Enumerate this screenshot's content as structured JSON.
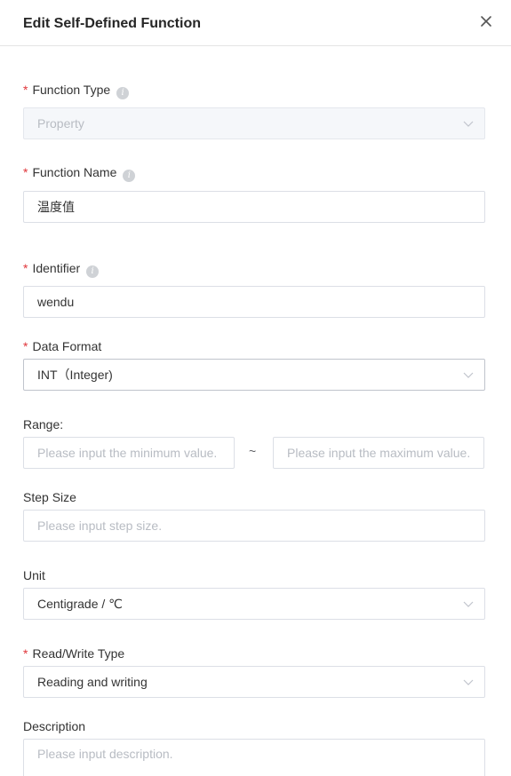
{
  "dialog": {
    "title": "Edit Self-Defined Function"
  },
  "icons": {
    "close": "close-icon",
    "info": "info-icon",
    "chevron": "chevron-down-icon"
  },
  "colors": {
    "required": "#e0353a",
    "border": "#dcdfe6",
    "disabled_bg": "#f5f7fa",
    "placeholder": "#b8bcc3"
  },
  "form": {
    "function_type": {
      "required": "*",
      "label": "Function Type",
      "value": "Property"
    },
    "function_name": {
      "required": "*",
      "label": "Function Name",
      "value": "温度值"
    },
    "identifier": {
      "required": "*",
      "label": "Identifier",
      "value": "wendu"
    },
    "data_format": {
      "required": "*",
      "label": "Data Format",
      "value": "INT（Integer)"
    },
    "range": {
      "label": "Range:",
      "min_placeholder": "Please input the minimum value.",
      "separator": "~",
      "max_placeholder": "Please input the maximum value."
    },
    "step_size": {
      "label": "Step Size",
      "placeholder": "Please input step size."
    },
    "unit": {
      "label": "Unit",
      "value": "Centigrade / ℃"
    },
    "read_write": {
      "required": "*",
      "label": "Read/Write Type",
      "value": "Reading and writing"
    },
    "description": {
      "label": "Description",
      "placeholder": "Please input description."
    }
  }
}
